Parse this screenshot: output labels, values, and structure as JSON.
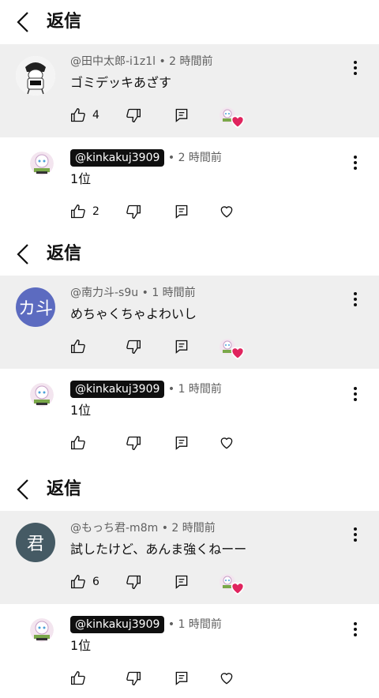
{
  "sections": [
    {
      "header": {
        "title": "返信"
      },
      "comment": {
        "avatar_letter": "",
        "avatar_color": "#ffffff",
        "author": "@田中太郎-i1z1l",
        "time": "2 時間前",
        "text": "ゴミデッキあざす",
        "likes": "4"
      },
      "reply": {
        "author": "@kinkakuj3909",
        "time": "2 時間前",
        "text": "1位",
        "likes": "2"
      }
    },
    {
      "header": {
        "title": "返信"
      },
      "comment": {
        "avatar_letter": "カ斗",
        "avatar_color": "#5c6bc0",
        "author": "@南力斗-s9u",
        "time": "1 時間前",
        "text": "めちゃくちゃよわいし",
        "likes": ""
      },
      "reply": {
        "author": "@kinkakuj3909",
        "time": "1 時間前",
        "text": "1位",
        "likes": ""
      }
    },
    {
      "header": {
        "title": "返信"
      },
      "comment": {
        "avatar_letter": "君",
        "avatar_color": "#455a64",
        "author": "@もっち君-m8m",
        "time": "2 時間前",
        "text": "試したけど、あんま強くねーー",
        "likes": "6"
      },
      "reply": {
        "author": "@kinkakuj3909",
        "time": "1 時間前",
        "text": "1位",
        "likes": ""
      }
    }
  ],
  "separator": "•",
  "icons": {
    "back": "chevron-left-icon",
    "like": "thumbs-up-icon",
    "dislike": "thumbs-down-icon",
    "reply": "reply-icon",
    "heart": "heart-icon",
    "more": "more-vert-icon"
  },
  "colors": {
    "comment_bg": "#efefef",
    "heart": "#e0245e",
    "chip": "#0f0f0f"
  }
}
